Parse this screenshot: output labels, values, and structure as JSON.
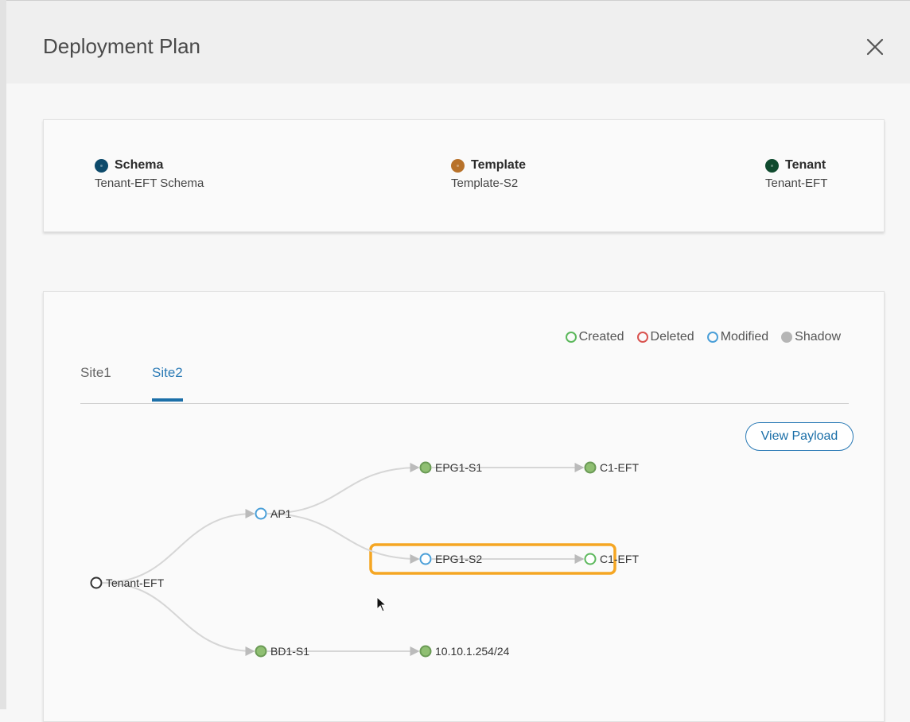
{
  "modal": {
    "title": "Deployment Plan"
  },
  "summary": {
    "schema": {
      "label": "Schema",
      "value": "Tenant-EFT Schema",
      "color": "#0d4a6b"
    },
    "template": {
      "label": "Template",
      "value": "Template-S2",
      "color": "#b8722a"
    },
    "tenant": {
      "label": "Tenant",
      "value": "Tenant-EFT",
      "color": "#0f4a2e"
    }
  },
  "legend": [
    {
      "label": "Created",
      "color": "#5cb85c",
      "style": "ring"
    },
    {
      "label": "Deleted",
      "color": "#d9534f",
      "style": "ring"
    },
    {
      "label": "Modified",
      "color": "#4a9fd8",
      "style": "ring"
    },
    {
      "label": "Shadow",
      "color": "#b5b5b5",
      "style": "filled"
    }
  ],
  "tabs": [
    {
      "label": "Site1",
      "active": false
    },
    {
      "label": "Site2",
      "active": true
    }
  ],
  "view_payload_label": "View Payload",
  "graph": {
    "nodes": [
      {
        "id": "tenant",
        "label": "Tenant-EFT",
        "status": "root"
      },
      {
        "id": "ap1",
        "label": "AP1",
        "status": "modified"
      },
      {
        "id": "epg1s1",
        "label": "EPG1-S1",
        "status": "shadow"
      },
      {
        "id": "c1eft-top",
        "label": "C1-EFT",
        "status": "shadow"
      },
      {
        "id": "epg1s2",
        "label": "EPG1-S2",
        "status": "modified",
        "highlighted": true
      },
      {
        "id": "c1eft-mid",
        "label": "C1-EFT",
        "status": "created",
        "highlighted": true
      },
      {
        "id": "bd1s1",
        "label": "BD1-S1",
        "status": "shadow"
      },
      {
        "id": "subnet",
        "label": "10.10.1.254/24",
        "status": "shadow"
      }
    ],
    "edges": [
      [
        "tenant",
        "ap1"
      ],
      [
        "tenant",
        "bd1s1"
      ],
      [
        "ap1",
        "epg1s1"
      ],
      [
        "ap1",
        "epg1s2"
      ],
      [
        "epg1s1",
        "c1eft-top"
      ],
      [
        "epg1s2",
        "c1eft-mid"
      ],
      [
        "bd1s1",
        "subnet"
      ]
    ],
    "highlight_color": "#f5a623"
  }
}
